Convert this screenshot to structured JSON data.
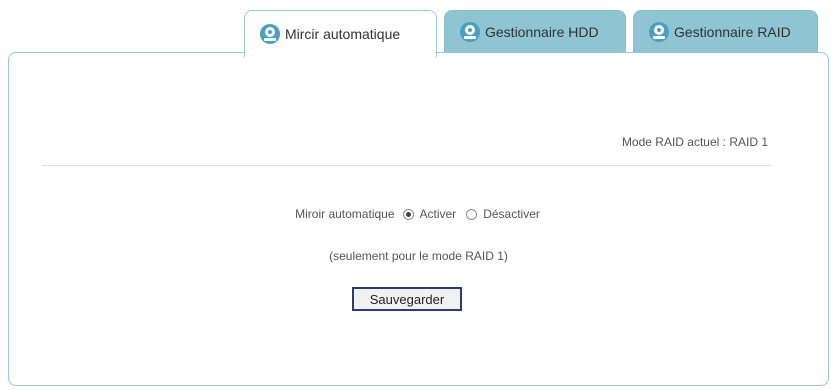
{
  "tabs": [
    {
      "label": "Mircir automatique",
      "icon": "hdd-icon",
      "active": true
    },
    {
      "label": "Gestionnaire HDD",
      "icon": "hdd-icon",
      "active": false
    },
    {
      "label": "Gestionnaire RAID",
      "icon": "hdd-icon",
      "active": false
    }
  ],
  "panel": {
    "raid_mode": "Mode RAID actuel : RAID 1",
    "mirror_label": "Miroir automatique",
    "option_activate": "Activer",
    "option_deactivate": "Désactiver",
    "selected_option": "Activer",
    "note": "(seulement pour le mode RAID 1)",
    "save_label": "Sauvegarder"
  },
  "colors": {
    "tab_inactive": "#8fc4d3",
    "border": "#9cc7d3",
    "button_border": "#2f3a72"
  }
}
